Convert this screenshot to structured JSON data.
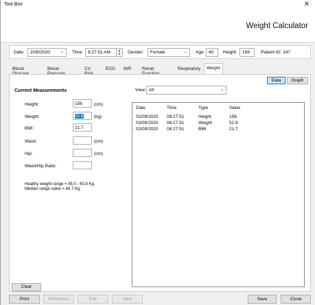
{
  "window": {
    "title": "Tool Box",
    "close_glyph": "✕"
  },
  "header": {
    "app_title": "Weight Calculator"
  },
  "infobar": {
    "date_label": "Date:",
    "date_value": "2/09/2020",
    "time_label": "Time:",
    "time_value": "8:27:51 AM",
    "gender_label": "Gender:",
    "gender_value": "Female",
    "age_label": "Age:",
    "age_value": "40",
    "height_label": "Height:",
    "height_value": "156",
    "patient_id": "Patient ID: 147"
  },
  "tabs": [
    "Blood Glucose",
    "Blood Pressure",
    "CV Risk",
    "ECG",
    "INR",
    "Renal Function",
    "Respiratory",
    "Weight"
  ],
  "active_tab": "Weight",
  "view_toggle": {
    "data": "Data",
    "graph": "Graph"
  },
  "measurements": {
    "title": "Current Measurements",
    "height_label": "Height:",
    "height_value": "156",
    "height_unit": "(cm)",
    "weight_label": "Weight:",
    "weight_value": "52.8",
    "weight_unit": "(kg)",
    "bmi_label": "BMI:",
    "bmi_value": "21.7",
    "waist_label": "Waist:",
    "waist_value": "",
    "waist_unit": "(cm)",
    "hip_label": "Hip:",
    "hip_value": "",
    "hip_unit": "(cm)",
    "ratio_label": "Waist/Hip Ratio:",
    "ratio_value": "",
    "healthy_range": "Healthy weight range = 45.0 - 60.8 Kg.",
    "median_value": "Median range value = 48.7 Kg."
  },
  "view": {
    "label": "View:",
    "value": "All"
  },
  "list": {
    "columns": [
      "Date",
      "Time",
      "Type",
      "Value"
    ],
    "rows": [
      [
        "02/09/2020",
        "08:27:51",
        "Height",
        "156"
      ],
      [
        "02/09/2020",
        "08:27:51",
        "Weight",
        "52.8"
      ],
      [
        "02/09/2020",
        "08:27:51",
        "BMI",
        "21.7"
      ]
    ]
  },
  "buttons": {
    "clear": "Clear",
    "print": "Print",
    "reference": "Reference",
    "edit": "Edit",
    "view": "View",
    "save": "Save",
    "close": "Close"
  }
}
